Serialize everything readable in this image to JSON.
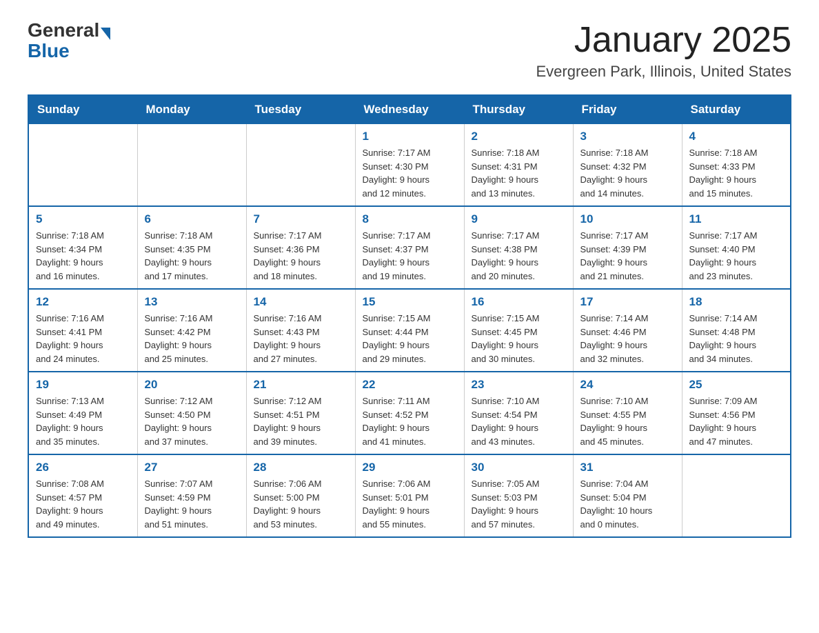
{
  "header": {
    "logo_general": "General",
    "logo_blue": "Blue",
    "title": "January 2025",
    "subtitle": "Evergreen Park, Illinois, United States"
  },
  "calendar": {
    "days_of_week": [
      "Sunday",
      "Monday",
      "Tuesday",
      "Wednesday",
      "Thursday",
      "Friday",
      "Saturday"
    ],
    "weeks": [
      [
        {
          "day": "",
          "info": ""
        },
        {
          "day": "",
          "info": ""
        },
        {
          "day": "",
          "info": ""
        },
        {
          "day": "1",
          "info": "Sunrise: 7:17 AM\nSunset: 4:30 PM\nDaylight: 9 hours\nand 12 minutes."
        },
        {
          "day": "2",
          "info": "Sunrise: 7:18 AM\nSunset: 4:31 PM\nDaylight: 9 hours\nand 13 minutes."
        },
        {
          "day": "3",
          "info": "Sunrise: 7:18 AM\nSunset: 4:32 PM\nDaylight: 9 hours\nand 14 minutes."
        },
        {
          "day": "4",
          "info": "Sunrise: 7:18 AM\nSunset: 4:33 PM\nDaylight: 9 hours\nand 15 minutes."
        }
      ],
      [
        {
          "day": "5",
          "info": "Sunrise: 7:18 AM\nSunset: 4:34 PM\nDaylight: 9 hours\nand 16 minutes."
        },
        {
          "day": "6",
          "info": "Sunrise: 7:18 AM\nSunset: 4:35 PM\nDaylight: 9 hours\nand 17 minutes."
        },
        {
          "day": "7",
          "info": "Sunrise: 7:17 AM\nSunset: 4:36 PM\nDaylight: 9 hours\nand 18 minutes."
        },
        {
          "day": "8",
          "info": "Sunrise: 7:17 AM\nSunset: 4:37 PM\nDaylight: 9 hours\nand 19 minutes."
        },
        {
          "day": "9",
          "info": "Sunrise: 7:17 AM\nSunset: 4:38 PM\nDaylight: 9 hours\nand 20 minutes."
        },
        {
          "day": "10",
          "info": "Sunrise: 7:17 AM\nSunset: 4:39 PM\nDaylight: 9 hours\nand 21 minutes."
        },
        {
          "day": "11",
          "info": "Sunrise: 7:17 AM\nSunset: 4:40 PM\nDaylight: 9 hours\nand 23 minutes."
        }
      ],
      [
        {
          "day": "12",
          "info": "Sunrise: 7:16 AM\nSunset: 4:41 PM\nDaylight: 9 hours\nand 24 minutes."
        },
        {
          "day": "13",
          "info": "Sunrise: 7:16 AM\nSunset: 4:42 PM\nDaylight: 9 hours\nand 25 minutes."
        },
        {
          "day": "14",
          "info": "Sunrise: 7:16 AM\nSunset: 4:43 PM\nDaylight: 9 hours\nand 27 minutes."
        },
        {
          "day": "15",
          "info": "Sunrise: 7:15 AM\nSunset: 4:44 PM\nDaylight: 9 hours\nand 29 minutes."
        },
        {
          "day": "16",
          "info": "Sunrise: 7:15 AM\nSunset: 4:45 PM\nDaylight: 9 hours\nand 30 minutes."
        },
        {
          "day": "17",
          "info": "Sunrise: 7:14 AM\nSunset: 4:46 PM\nDaylight: 9 hours\nand 32 minutes."
        },
        {
          "day": "18",
          "info": "Sunrise: 7:14 AM\nSunset: 4:48 PM\nDaylight: 9 hours\nand 34 minutes."
        }
      ],
      [
        {
          "day": "19",
          "info": "Sunrise: 7:13 AM\nSunset: 4:49 PM\nDaylight: 9 hours\nand 35 minutes."
        },
        {
          "day": "20",
          "info": "Sunrise: 7:12 AM\nSunset: 4:50 PM\nDaylight: 9 hours\nand 37 minutes."
        },
        {
          "day": "21",
          "info": "Sunrise: 7:12 AM\nSunset: 4:51 PM\nDaylight: 9 hours\nand 39 minutes."
        },
        {
          "day": "22",
          "info": "Sunrise: 7:11 AM\nSunset: 4:52 PM\nDaylight: 9 hours\nand 41 minutes."
        },
        {
          "day": "23",
          "info": "Sunrise: 7:10 AM\nSunset: 4:54 PM\nDaylight: 9 hours\nand 43 minutes."
        },
        {
          "day": "24",
          "info": "Sunrise: 7:10 AM\nSunset: 4:55 PM\nDaylight: 9 hours\nand 45 minutes."
        },
        {
          "day": "25",
          "info": "Sunrise: 7:09 AM\nSunset: 4:56 PM\nDaylight: 9 hours\nand 47 minutes."
        }
      ],
      [
        {
          "day": "26",
          "info": "Sunrise: 7:08 AM\nSunset: 4:57 PM\nDaylight: 9 hours\nand 49 minutes."
        },
        {
          "day": "27",
          "info": "Sunrise: 7:07 AM\nSunset: 4:59 PM\nDaylight: 9 hours\nand 51 minutes."
        },
        {
          "day": "28",
          "info": "Sunrise: 7:06 AM\nSunset: 5:00 PM\nDaylight: 9 hours\nand 53 minutes."
        },
        {
          "day": "29",
          "info": "Sunrise: 7:06 AM\nSunset: 5:01 PM\nDaylight: 9 hours\nand 55 minutes."
        },
        {
          "day": "30",
          "info": "Sunrise: 7:05 AM\nSunset: 5:03 PM\nDaylight: 9 hours\nand 57 minutes."
        },
        {
          "day": "31",
          "info": "Sunrise: 7:04 AM\nSunset: 5:04 PM\nDaylight: 10 hours\nand 0 minutes."
        },
        {
          "day": "",
          "info": ""
        }
      ]
    ]
  }
}
